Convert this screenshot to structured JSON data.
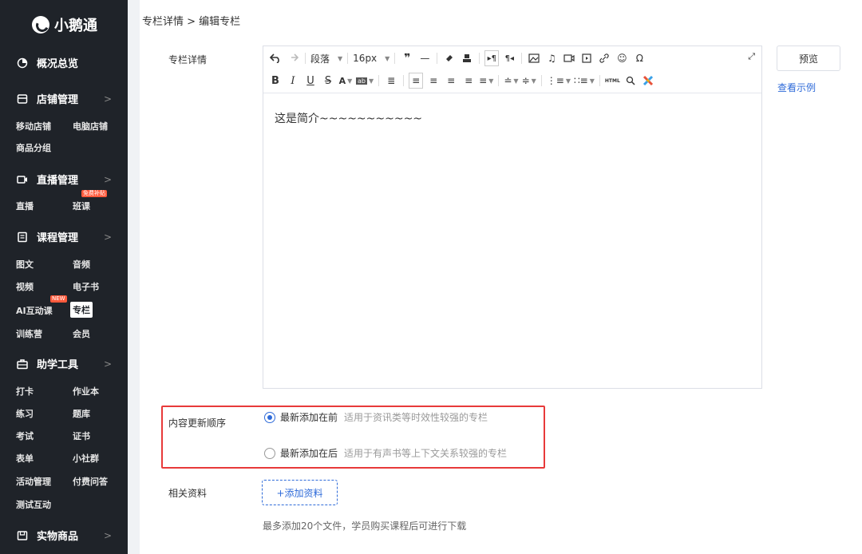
{
  "app": {
    "logo_text": "小鹅通"
  },
  "sidebar": {
    "overview": "概况总览",
    "groups": [
      {
        "label": "店铺管理",
        "icon": "store-icon"
      },
      {
        "label": "直播管理",
        "icon": "live-icon"
      },
      {
        "label": "课程管理",
        "icon": "course-icon"
      },
      {
        "label": "助学工具",
        "icon": "toolbox-icon"
      },
      {
        "label": "实物商品",
        "icon": "product-icon"
      }
    ],
    "items": {
      "mobile_store": "移动店铺",
      "pc_store": "电脑店铺",
      "product_group": "商品分组",
      "live": "直播",
      "class": "班课",
      "class_badge": "免费补贴",
      "graphic": "图文",
      "audio": "音频",
      "video": "视频",
      "ebook": "电子书",
      "ai_course": "AI互动课",
      "ai_badge": "NEW",
      "column": "专栏",
      "training": "训练营",
      "member": "会员",
      "checkin": "打卡",
      "homework": "作业本",
      "practice": "练习",
      "question_bank": "题库",
      "exam": "考试",
      "certificate": "证书",
      "form": "表单",
      "community": "小社群",
      "activity": "活动管理",
      "paid_qa": "付费问答",
      "test_interact": "测试互动"
    },
    "chevron": ">"
  },
  "breadcrumb": "专栏详情 > 编辑专栏",
  "form": {
    "detail_label": "专栏详情",
    "order_label": "内容更新顺序",
    "material_label": "相关资料"
  },
  "editor": {
    "paragraph": "段落",
    "font_size": "16px",
    "content": "这是简介~~~~~~~~~~~"
  },
  "preview_button": "预览",
  "example_link": "查看示例",
  "order_options": [
    {
      "label": "最新添加在前",
      "desc": "适用于资讯类等时效性较强的专栏",
      "selected": true
    },
    {
      "label": "最新添加在后",
      "desc": "适用于有声书等上下文关系较强的专栏",
      "selected": false
    }
  ],
  "add_material_button": "+添加资料",
  "material_hint": "最多添加20个文件，学员购买课程后可进行下载",
  "colors": {
    "sidebar_bg": "#1f2329",
    "accent": "#2f6bd9",
    "highlight_border": "#e83a3a"
  }
}
